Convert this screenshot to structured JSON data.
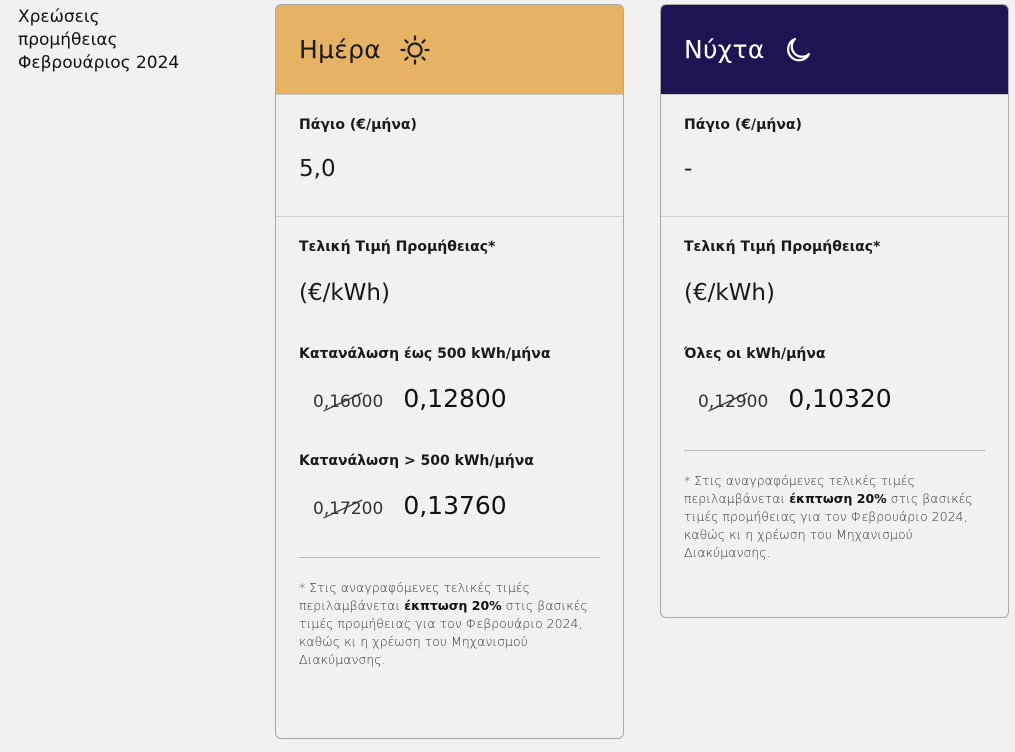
{
  "side_title": {
    "line1": "Χρεώσεις",
    "line2": "προμήθειας",
    "line3": "Φεβρουάριος 2024"
  },
  "day": {
    "title": "Ημέρα",
    "icon": "sun-icon",
    "fee_label": "Πάγιο (€/μήνα)",
    "fee_value": "5,0",
    "price_label": "Τελική Τιμή Προμήθειας*",
    "unit": "(€/kWh)",
    "tiers": [
      {
        "label": "Κατανάλωση έως 500 kWh/μήνα",
        "old_price": "0,16000",
        "new_price": "0,12800"
      },
      {
        "label": "Κατανάλωση > 500 kWh/μήνα",
        "old_price": "0,17200",
        "new_price": "0,13760"
      }
    ],
    "footnote": {
      "before": "* Στις αναγραφόμενες τελικές τιμές περιλαμβάνεται ",
      "bold": "έκπτωση 20%",
      "after": " στις βασικές τιμές προμήθειας για τον Φεβρουάριο 2024, καθώς κι η χρέωση του Μηχανισμού Διακύμανσης."
    }
  },
  "night": {
    "title": "Νύχτα",
    "icon": "moon-icon",
    "fee_label": "Πάγιο (€/μήνα)",
    "fee_value": "-",
    "price_label": "Τελική Τιμή Προμήθειας*",
    "unit": "(€/kWh)",
    "tiers": [
      {
        "label": "Όλες οι kWh/μήνα",
        "old_price": "0,12900",
        "new_price": "0,10320"
      }
    ],
    "footnote": {
      "before": "* Στις αναγραφόμενες τελικές τιμές περιλαμβάνεται ",
      "bold": "έκπτωση 20%",
      "after": " στις βασικές τιμές προμήθειας για τον Φεβρουάριο 2024, καθώς κι η χρέωση του Μηχανισμού Διακύμανσης."
    }
  },
  "colors": {
    "day_header": "#e6b264",
    "night_header": "#1f1453",
    "background": "#f1f1f1"
  }
}
